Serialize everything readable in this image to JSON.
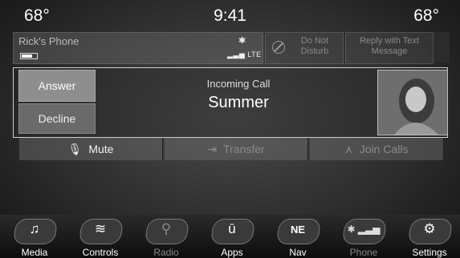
{
  "status_bar": {
    "temp_left": "68°",
    "time": "9:41",
    "temp_right": "68°"
  },
  "phone_bar": {
    "device_name": "Rick's Phone",
    "bluetooth_icon": "bluetooth-icon",
    "network": "LTE",
    "battery_level": 0.7,
    "do_not_disturb": "Do Not Disturb",
    "reply_text": "Reply with Text Message"
  },
  "call": {
    "incoming_label": "Incoming Call",
    "caller_name": "Summer",
    "answer_label": "Answer",
    "decline_label": "Decline"
  },
  "actions": {
    "mute_label": "Mute",
    "transfer_label": "Transfer",
    "join_label": "Join Calls"
  },
  "nav": {
    "items": [
      {
        "label": "Media",
        "icon": "music-note-icon"
      },
      {
        "label": "Controls",
        "icon": "controls-icon"
      },
      {
        "label": "Radio",
        "icon": "radio-tower-icon"
      },
      {
        "label": "Apps",
        "icon": "apps-icon",
        "glyph": "ū"
      },
      {
        "label": "Nav",
        "icon": "compass-icon",
        "glyph": "NE"
      },
      {
        "label": "Phone",
        "icon": "phone-icon"
      },
      {
        "label": "Settings",
        "icon": "gear-icon"
      }
    ]
  }
}
